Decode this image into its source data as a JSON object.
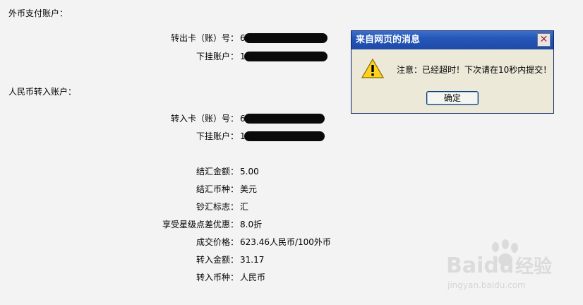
{
  "foreign_payment": {
    "section_title": "外币支付账户：",
    "rows": [
      {
        "label": "转出卡（账）号：",
        "value": "6"
      },
      {
        "label": "下挂账户：",
        "value": "1"
      }
    ]
  },
  "rmb_receive": {
    "section_title": "人民币转入账户：",
    "rows": [
      {
        "label": "转入卡（账）号：",
        "value": "6"
      },
      {
        "label": "下挂账户：",
        "value": "1"
      }
    ]
  },
  "details": [
    {
      "label": "结汇金额：",
      "value": "5.00"
    },
    {
      "label": "结汇币种：",
      "value": "美元"
    },
    {
      "label": "钞汇标志：",
      "value": "汇"
    },
    {
      "label": "享受星级点差优惠：",
      "value": "8.0折"
    },
    {
      "label": "成交价格：",
      "value": "623.46人民币/100外币"
    },
    {
      "label": "转入金额：",
      "value": "31.17"
    },
    {
      "label": "转入币种：",
      "value": "人民币"
    }
  ],
  "dialog": {
    "title": "来自网页的消息",
    "message": "注意：已经超时！下次请在10秒内提交！",
    "ok_label": "确定",
    "close_glyph": "✕",
    "icon": "warning-icon"
  },
  "watermark": {
    "brand": "Baidu",
    "cn": "经验",
    "url": "jingyan.baidu.com"
  },
  "colors": {
    "background": "#f3f3f3",
    "titlebar": "#2456b8",
    "dialog_bg": "#ece9d8",
    "redaction": "#0a0a0a"
  }
}
